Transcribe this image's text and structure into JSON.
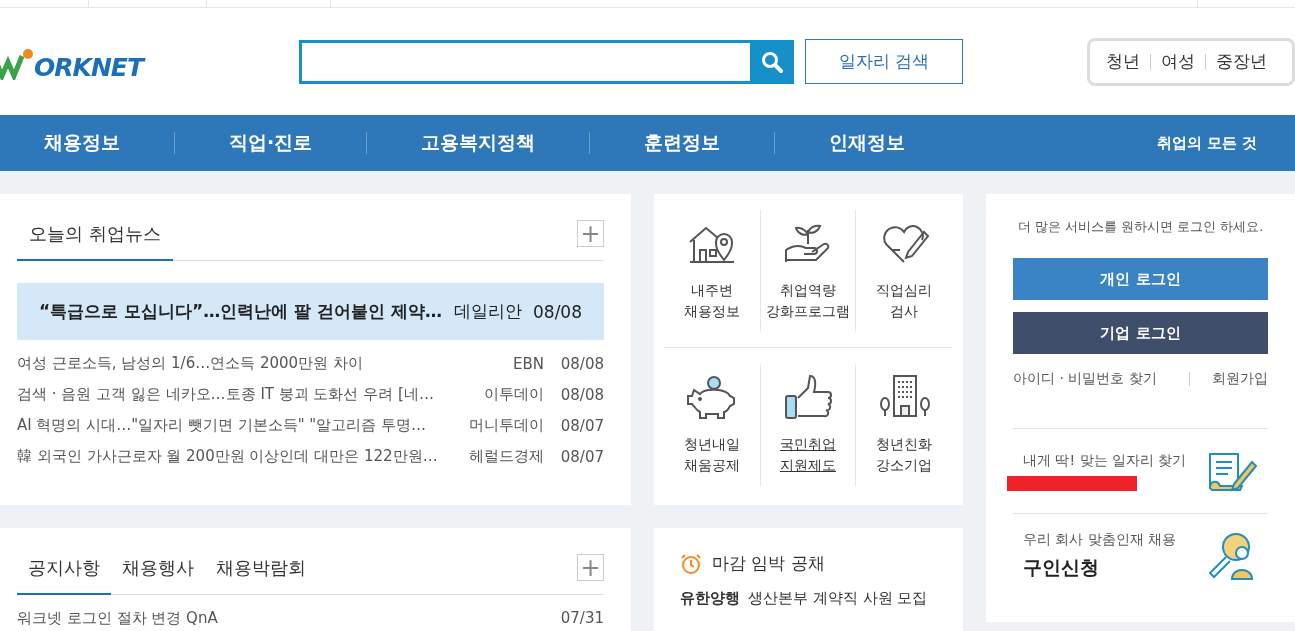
{
  "logo": {
    "text": "ORKNET"
  },
  "search": {
    "button": "일자리 검색"
  },
  "audience": [
    {
      "label": "청년"
    },
    {
      "label": "여성"
    },
    {
      "label": "중장년"
    }
  ],
  "nav": {
    "items": [
      "채용정보",
      "직업·진로",
      "고용복지정책",
      "훈련정보",
      "인재정보"
    ],
    "extra": "취업의 모든 것"
  },
  "news": {
    "title": "오늘의 취업뉴스",
    "more": "+",
    "items": [
      {
        "title": "“특급으로 모십니다”…인력난에 팔 걷어붙인 제약…",
        "source": "데일리안",
        "date": "08/08",
        "selected": true
      },
      {
        "title": "여성 근로소득, 남성의 1/6…연소득 2000만원 차이",
        "source": "EBN",
        "date": "08/08",
        "selected": false
      },
      {
        "title": "검색 · 음원 고객 잃은 네카오…토종 IT 붕괴 도화선 우려 [네…",
        "source": "이투데이",
        "date": "08/08",
        "selected": false
      },
      {
        "title": "AI 혁명의 시대…\"일자리 뺏기면 기본소득\" \"알고리즘 투명…",
        "source": "머니투데이",
        "date": "08/07",
        "selected": false
      },
      {
        "title": "韓 외국인 가사근로자 월 200만원 이상인데 대만은 122만원…",
        "source": "헤럴드경제",
        "date": "08/07",
        "selected": false
      }
    ]
  },
  "services": [
    {
      "kind": "house",
      "lines": [
        "내주변",
        "채용정보"
      ],
      "underlined": false
    },
    {
      "kind": "sprout",
      "lines": [
        "취업역량",
        "강화프로그램"
      ],
      "underlined": false
    },
    {
      "kind": "heart",
      "lines": [
        "직업심리",
        "검사"
      ],
      "underlined": false
    },
    {
      "kind": "piggy",
      "lines": [
        "청년내일",
        "채움공제"
      ],
      "underlined": false
    },
    {
      "kind": "thumb",
      "lines": [
        "국민취업",
        "지원제도"
      ],
      "underlined": true
    },
    {
      "kind": "building",
      "lines": [
        "청년친화",
        "강소기업"
      ],
      "underlined": false
    }
  ],
  "login": {
    "prompt": "더 많은 서비스를 원하시면 로그인 하세요.",
    "buttons": [
      {
        "label": "개인 로그인",
        "kind": "personal"
      },
      {
        "label": "기업 로그인",
        "kind": "company"
      }
    ],
    "find": "아이디 · 비밀번호 찾기",
    "join": "회원가입"
  },
  "promos": [
    {
      "kind": "document",
      "subtitle": "내게 딱! 맞는 일자리 찾기",
      "redacted": true
    },
    {
      "kind": "magnifier",
      "subtitle": "우리 회사 맞춤인재 채용",
      "title": "구인신청",
      "redacted": false
    }
  ],
  "notices": {
    "tabs": [
      {
        "label": "공지사항",
        "selected": true
      },
      {
        "label": "채용행사",
        "selected": false
      },
      {
        "label": "채용박람회",
        "selected": false
      }
    ],
    "more": "+",
    "items": [
      {
        "title": "워크넷 로그인 절차 변경 QnA",
        "date": "07/31"
      }
    ]
  },
  "deadline": {
    "title": "마감 임박 공채",
    "items": [
      {
        "company": "유한양행",
        "job": "생산본부 계약직 사원 모집"
      }
    ]
  }
}
